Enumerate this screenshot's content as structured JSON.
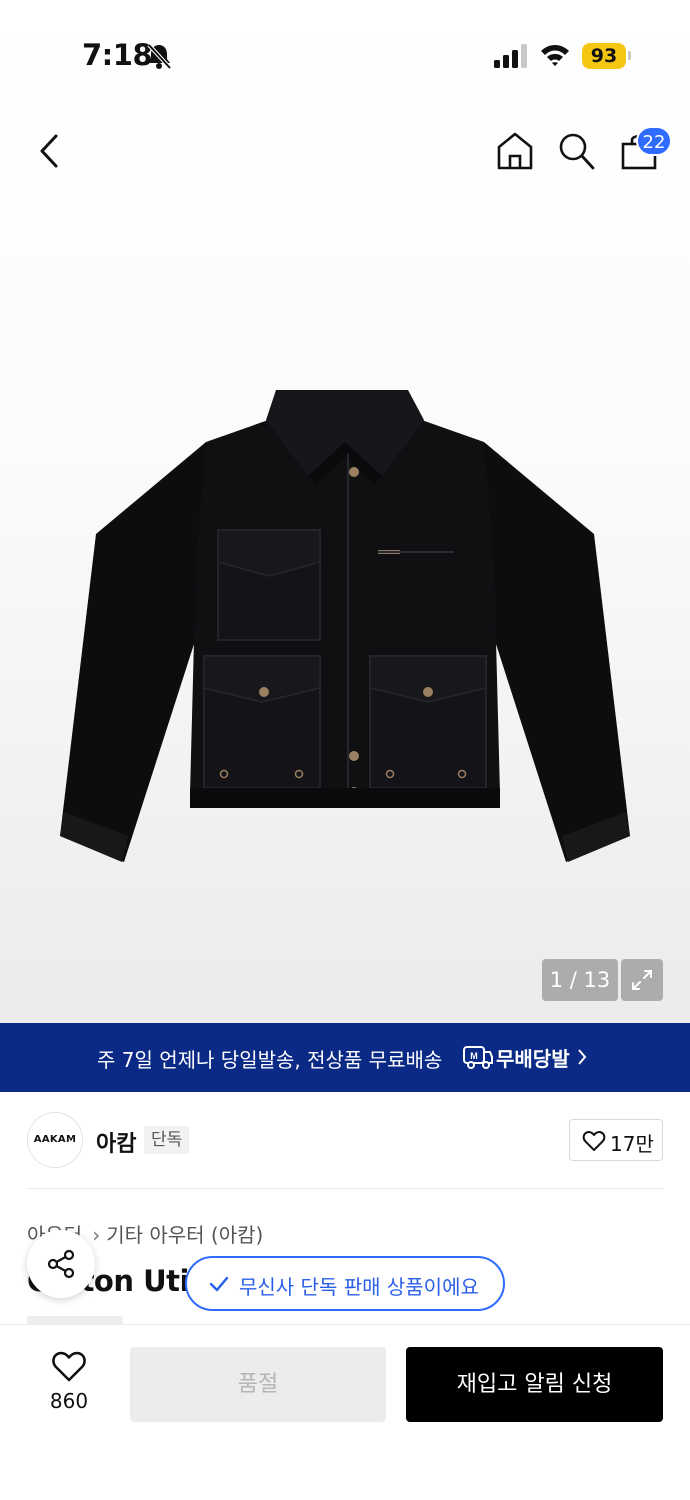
{
  "status_bar": {
    "time": "7:18",
    "battery": "93",
    "icons": [
      "bell-slash-icon",
      "signal-icon",
      "wifi-icon",
      "battery-icon"
    ]
  },
  "nav": {
    "icons": [
      "back-arrow-icon",
      "home-icon",
      "search-icon",
      "shopping-bag-icon"
    ],
    "cart_count": "22"
  },
  "gallery": {
    "counter": "1 / 13",
    "expand_icon": "expand-icon"
  },
  "promo": {
    "text": "주 7일 언제나 당일발송, 전상품 무료배송",
    "brand": "무배당발",
    "logo_icon": "delivery-truck-icon"
  },
  "brand": {
    "logo_text": "AAKAM",
    "name": "아캄",
    "tag": "단독",
    "likes": "17만"
  },
  "breadcrumb": {
    "level1": "아우터",
    "level2": "기타 아우터 (아캄)"
  },
  "product": {
    "title_partial": "Cotton Utili"
  },
  "exclusive_notice": {
    "text": "무신사 단독 판매 상품이에요"
  },
  "bottom_bar": {
    "wish_count": "860",
    "soldout_label": "품절",
    "restock_label": "재입고 알림 신청"
  },
  "colors": {
    "promo_bg": "#0a2a86",
    "accent_blue": "#2f6bff",
    "battery_yellow": "#f5c712",
    "primary_button": "#000000"
  }
}
